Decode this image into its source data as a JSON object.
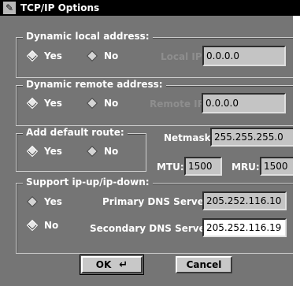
{
  "window": {
    "title": "TCP/IP Options"
  },
  "dynamic_local": {
    "legend": "Dynamic local address:",
    "yes_label": "Yes",
    "no_label": "No",
    "ip_label": "Local IP:",
    "ip_value": "0.0.0.0"
  },
  "dynamic_remote": {
    "legend": "Dynamic remote address:",
    "yes_label": "Yes",
    "no_label": "No",
    "ip_label": "Remote IP:",
    "ip_value": "0.0.0.0"
  },
  "default_route": {
    "legend": "Add default route:",
    "yes_label": "Yes",
    "no_label": "No"
  },
  "netmask": {
    "label": "Netmask:",
    "value": "255.255.255.0"
  },
  "mtu": {
    "label": "MTU:",
    "value": "1500"
  },
  "mru": {
    "label": "MRU:",
    "value": "1500"
  },
  "ipup": {
    "legend": "Support ip-up/ip-down:",
    "yes_label": "Yes",
    "no_label": "No",
    "primary_dns_label": "Primary DNS Server:",
    "primary_dns_value": "205.252.116.10",
    "secondary_dns_label": "Secondary DNS Server:",
    "secondary_dns_value": "205.252.116.19"
  },
  "buttons": {
    "ok_label": "OK",
    "cancel_label": "Cancel"
  },
  "icons": {
    "window_icon": "pen-icon",
    "return_icon": "return-arrow-icon"
  }
}
